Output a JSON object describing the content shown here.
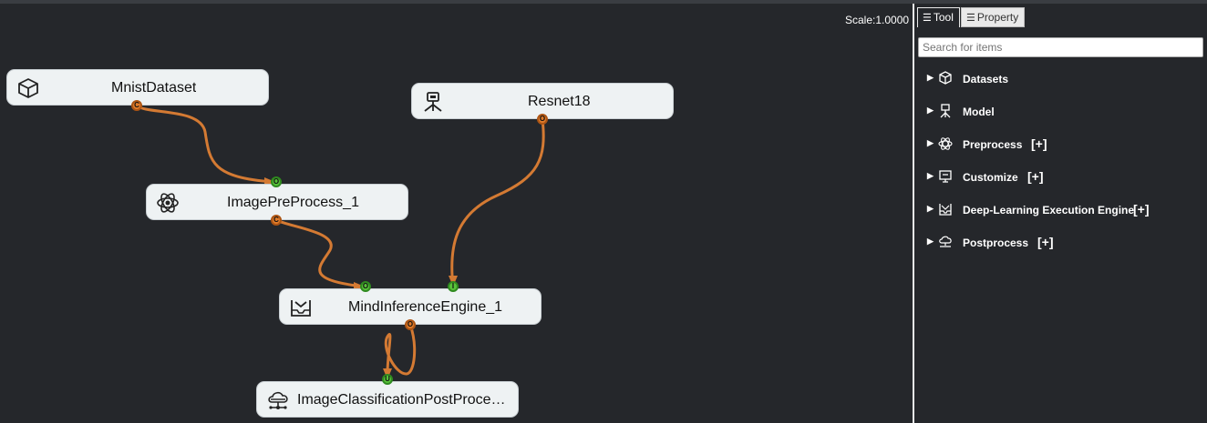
{
  "canvas": {
    "scale_label": "Scale:1.0000",
    "nodes": [
      {
        "id": "mnist",
        "label": "MnistDataset",
        "icon": "cube-icon",
        "ports": [
          "C"
        ]
      },
      {
        "id": "resnet",
        "label": "Resnet18",
        "icon": "model-icon",
        "ports": [
          "O"
        ]
      },
      {
        "id": "preprocess",
        "label": "ImagePreProcess_1",
        "icon": "atom-icon",
        "ports": [
          "O",
          "C"
        ]
      },
      {
        "id": "engine",
        "label": "MindInferenceEngine_1",
        "icon": "inbox-icon",
        "ports": [
          "O",
          "I",
          "O"
        ]
      },
      {
        "id": "postprocess",
        "label": "ImageClassificationPostProce…",
        "icon": "cloud-network-icon",
        "ports": [
          "U"
        ]
      }
    ]
  },
  "panel": {
    "tabs": [
      {
        "label": "Tool",
        "icon": "list-icon",
        "active": true
      },
      {
        "label": "Property",
        "icon": "list-icon",
        "active": false
      }
    ],
    "search_placeholder": "Search for items",
    "plus_label": "[+]",
    "items": [
      {
        "label": "Datasets",
        "icon": "cube-icon",
        "has_plus": false
      },
      {
        "label": "Model",
        "icon": "model-icon",
        "has_plus": false
      },
      {
        "label": "Preprocess",
        "icon": "atom-icon",
        "has_plus": true
      },
      {
        "label": "Customize",
        "icon": "customize-icon",
        "has_plus": true
      },
      {
        "label": "Deep-Learning Execution Engine",
        "icon": "inbox-icon",
        "has_plus": true
      },
      {
        "label": "Postprocess",
        "icon": "cloud-network-icon",
        "has_plus": true
      }
    ]
  },
  "colors": {
    "background": "#25272b",
    "link": "#d47a33",
    "output_port": "#e07b2a",
    "input_port": "#58c23a",
    "node_fill": "#eef2f3"
  }
}
